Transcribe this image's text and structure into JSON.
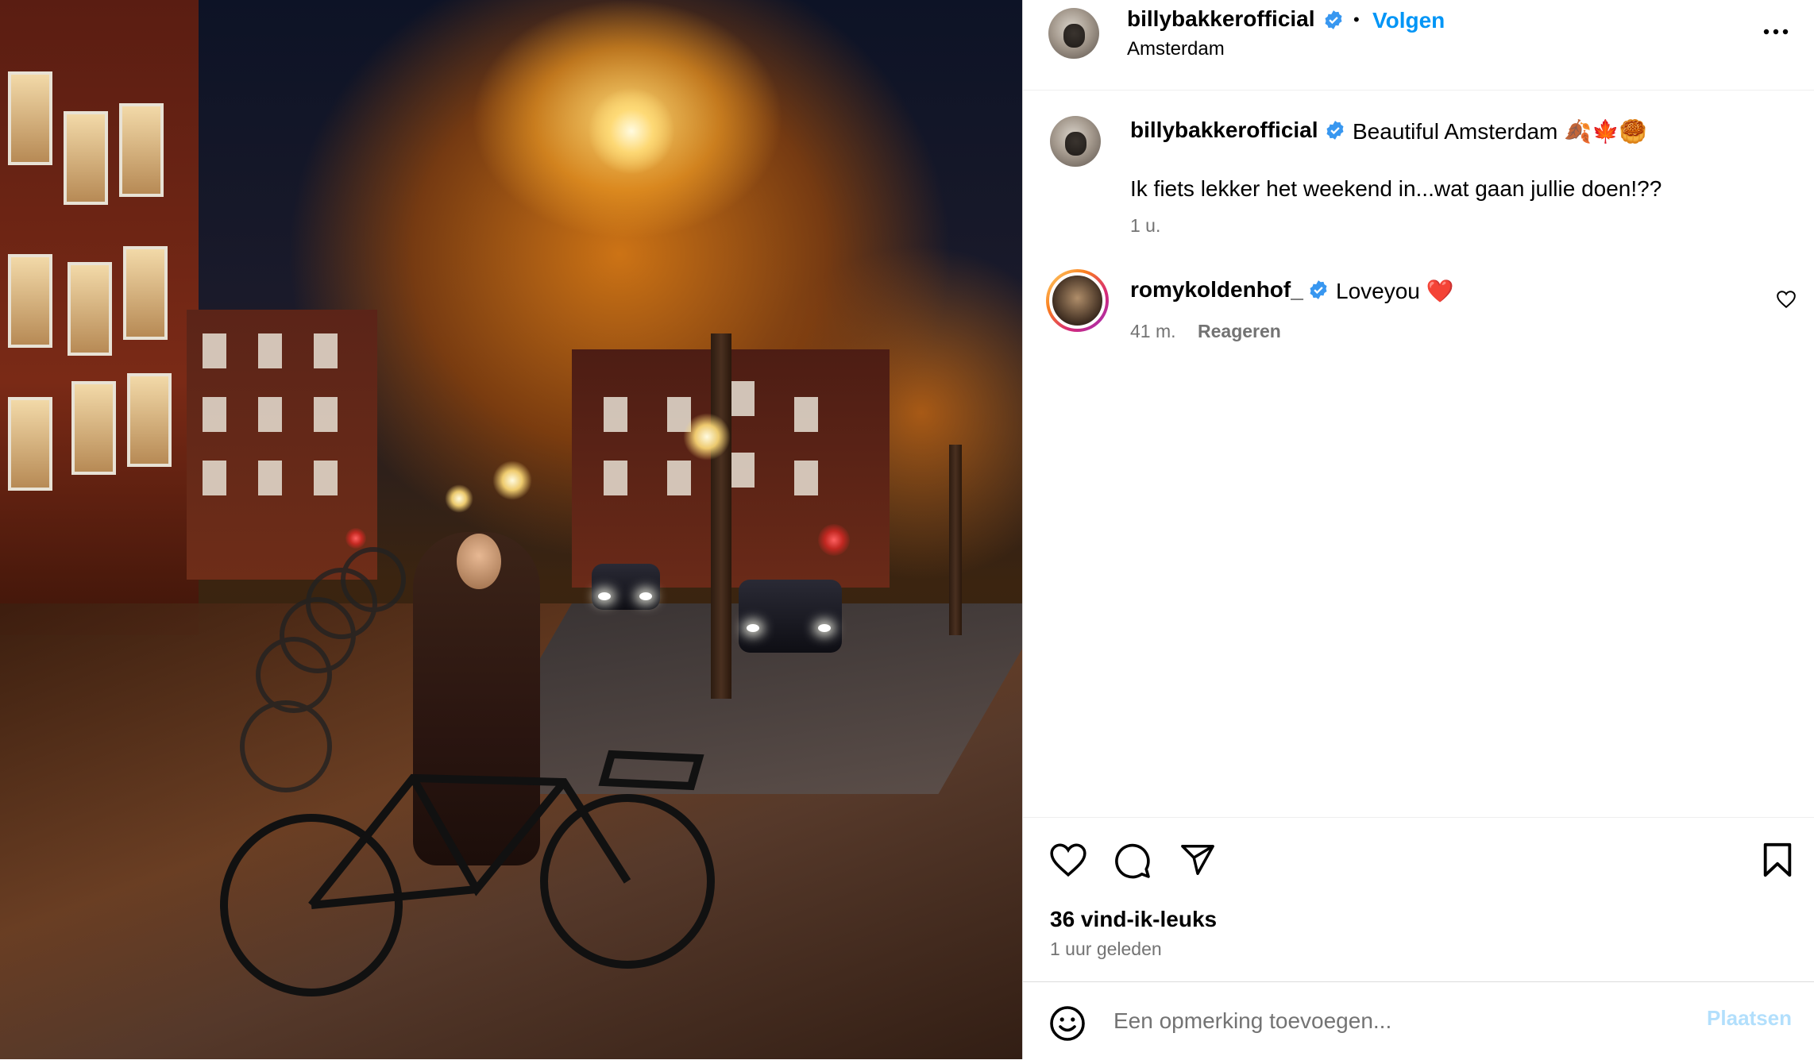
{
  "post": {
    "author": "billybakkerofficial",
    "follow_label": "Volgen",
    "separator": "•",
    "location": "Amsterdam",
    "caption_title": "Beautiful Amsterdam 🍂🍁🥮",
    "caption_body": "Ik fiets lekker het weekend in...wat gaan jullie doen!??",
    "caption_time": "1 u.",
    "likes": "36 vind-ik-leuks",
    "posted_ago": "1 uur geleden"
  },
  "comments": [
    {
      "author": "romykoldenhof_",
      "text": "Loveyou ❤️",
      "time": "41 m.",
      "reply_label": "Reageren"
    }
  ],
  "composer": {
    "placeholder": "Een opmerking toevoegen...",
    "post_label": "Plaatsen"
  },
  "icons": {
    "more": "more-horizontal-icon",
    "verified": "verified-badge-icon",
    "like": "heart-icon",
    "comment": "comment-bubble-icon",
    "share": "paper-plane-icon",
    "save": "bookmark-icon",
    "emoji": "emoji-smiley-icon",
    "comment_like": "small-heart-icon"
  },
  "colors": {
    "accent": "#0095f6",
    "secondary_text": "#737373",
    "post_disabled": "#b2dffc",
    "verified": "#3897f0"
  }
}
